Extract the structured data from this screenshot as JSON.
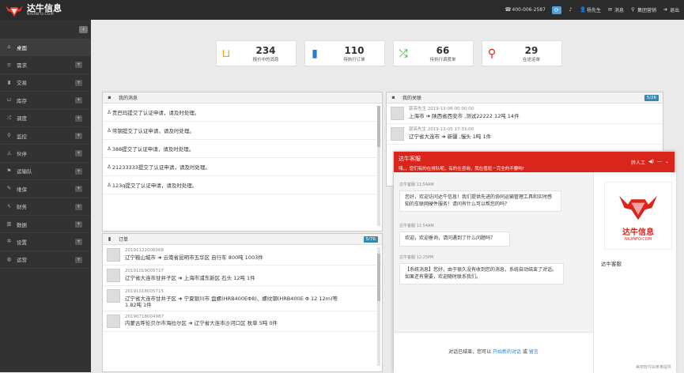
{
  "header": {
    "brand": "达牛信息",
    "brand_sub": "NIUINFO.COM",
    "phone": "400-006-2587",
    "user": "杨先生",
    "message": "消息",
    "nav": "集团营销",
    "exit": "退出"
  },
  "sidebar": {
    "items": [
      {
        "label": "桌面",
        "icon": "home-icon",
        "active": true
      },
      {
        "label": "需求",
        "icon": "list-icon"
      },
      {
        "label": "交易",
        "icon": "file-icon"
      },
      {
        "label": "库存",
        "icon": "cart-icon"
      },
      {
        "label": "调度",
        "icon": "shuffle-icon"
      },
      {
        "label": "监控",
        "icon": "location-icon"
      },
      {
        "label": "伙伴",
        "icon": "user-icon"
      },
      {
        "label": "运输队",
        "icon": "flag-icon"
      },
      {
        "label": "维保",
        "icon": "wrench-icon"
      },
      {
        "label": "财务",
        "icon": "bolt-icon"
      },
      {
        "label": "数据",
        "icon": "chart-icon"
      },
      {
        "label": "设置",
        "icon": "gear-icon"
      },
      {
        "label": "运营",
        "icon": "globe-icon"
      }
    ]
  },
  "stats": [
    {
      "num": "234",
      "label": "报价中的消息",
      "icon": "cart-icon",
      "color": "#f0a30a"
    },
    {
      "num": "110",
      "label": "待执行订单",
      "icon": "file-icon",
      "color": "#2a7ccf"
    },
    {
      "num": "66",
      "label": "待执行调度单",
      "icon": "shuffle-icon",
      "color": "#2aa02a"
    },
    {
      "num": "29",
      "label": "在途运单",
      "icon": "location-icon",
      "color": "#d9251b"
    }
  ],
  "messages": {
    "title": "我的消息",
    "items": [
      "贵巴玛提交了认证申请，请及时处理。",
      "常钢提交了认证申请，请及时处理。",
      "388提交了认证申请，请及时处理。",
      "21233333提交了认证申请，请及时处理。",
      "123q提交了认证申请，请及时处理。"
    ]
  },
  "tasks": {
    "title": "我的关联",
    "badge": "5/26",
    "items": [
      {
        "who": "郭亮先生",
        "time": "2019-12-06 00:00:00",
        "route": "上海市 ➜ 陕西省西安市 ,测试22222  12吨 14件"
      },
      {
        "who": "郭亮先生",
        "time": "2019-12-05 17:33:00",
        "route": "辽宁省大连市 ➜ 新疆 ,慢头  1吨 1件"
      }
    ]
  },
  "orders": {
    "title": "订单",
    "badge": "5/76",
    "items": [
      {
        "id": "20191122006068",
        "line1": "辽宁鞍山城市 ➜ 云南省昆明市五华区 自行车  800吨 1003件"
      },
      {
        "id": "20191019005717",
        "line1": "辽宁省大连市甘井子区 ➜ 上海市浦东新区 石头  12吨 1件"
      },
      {
        "id": "20191018005715",
        "line1": "辽宁省大连市甘井子区 ➜ 宁夏银川市 盘螺(HRB400EΦ8)、螺纹钢(HRB400E Φ 12 12m)等",
        "line2": "1.82吨 1件"
      },
      {
        "id": "20190718004987",
        "line1": "内蒙古呼伦贝尔市海拉尔区 ➜ 辽宁省大连市沙河口区 牧草  5吨 0件"
      }
    ]
  },
  "chat": {
    "title": "达牛客服",
    "subtitle": "嗨，，您们有的在排队呢，有的在咨询，我在值班－完全的不要哟!",
    "transfer": "转人工",
    "messages": [
      {
        "who": "达牛客服 11:54AM",
        "text": "您好，欢迎访问达牛信息！我们提供先进的协同运输管理工具和实时感知的车联网硬件服务！请问有什么可以帮您的吗？"
      },
      {
        "who": "达牛客服 11:54AM",
        "text": "欢迎，欢迎垂询，请问遇到了什么问题吗？"
      },
      {
        "who": "达牛客服 12:25PM",
        "text": "【系统消息】您好，由于很久没有收到您的消息，系统自动结束了对话。如果还有需要，欢迎随时联系我们。"
      }
    ],
    "footer_text": "对话已结束，您可以",
    "footer_link1": "开始新的对话",
    "footer_or": "或",
    "footer_link2": "留言",
    "side_brand": "达牛信息",
    "side_brand_sub": "NIUINFO.COM",
    "side_name": "达牛客服",
    "powered": "美丽软件由某某提供"
  }
}
